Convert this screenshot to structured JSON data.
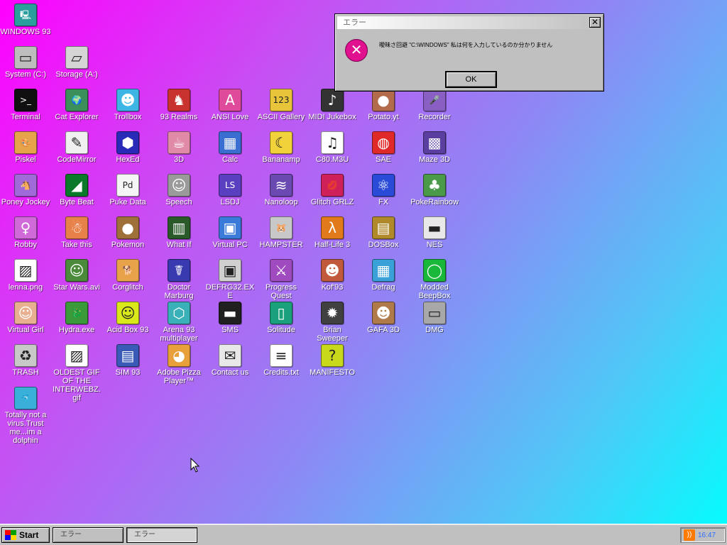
{
  "colors": {
    "gradient_start": "#ff00ff",
    "gradient_end": "#00ffff",
    "dialog_gray": "#c0c0c0",
    "error_icon": "#e0108f"
  },
  "desktop": {
    "icons": [
      {
        "label": "WINDOWS 93",
        "icon": "computer-icon",
        "glyph": "🖳",
        "bg": "#2a9d9d"
      },
      {
        "label": "System (C:)",
        "icon": "hard-drive-icon",
        "glyph": "▭",
        "bg": "#bdbdbd"
      },
      {
        "label": "Storage (A:)",
        "icon": "floppy-drive-icon",
        "glyph": "▱",
        "bg": "#d5d5d5"
      },
      {
        "label": "Terminal",
        "icon": "terminal-icon",
        "glyph": ">_",
        "bg": "#101010"
      },
      {
        "label": "Cat Explorer",
        "icon": "cat-explorer-icon",
        "glyph": "🌍",
        "bg": "#3a8f5a"
      },
      {
        "label": "Trollbox",
        "icon": "trollbox-icon",
        "glyph": "☻",
        "bg": "#3db6e6"
      },
      {
        "label": "93 Realms",
        "icon": "realms-icon",
        "glyph": "♞",
        "bg": "#c8322f"
      },
      {
        "label": "ANSI Love",
        "icon": "ansi-love-icon",
        "glyph": "A",
        "bg": "#e04a9a"
      },
      {
        "label": "ASCII Gallery",
        "icon": "ascii-gallery-icon",
        "glyph": "123",
        "bg": "#e8c43a"
      },
      {
        "label": "MIDI Jukebox",
        "icon": "midi-jukebox-icon",
        "glyph": "♪",
        "bg": "#333333"
      },
      {
        "label": "Potato.yt",
        "icon": "potato-icon",
        "glyph": "●",
        "bg": "#b26b4b"
      },
      {
        "label": "Recorder",
        "icon": "microphone-icon",
        "glyph": "🎤",
        "bg": "#8a5fc4"
      },
      {
        "label": "Piskel",
        "icon": "palette-icon",
        "glyph": "🎨",
        "bg": "#e6a34a"
      },
      {
        "label": "CodeMirror",
        "icon": "codemirror-icon",
        "glyph": "✎",
        "bg": "#f0f0f0"
      },
      {
        "label": "HexEd",
        "icon": "cube-icon",
        "glyph": "⬢",
        "bg": "#2a2ab8"
      },
      {
        "label": "3D",
        "icon": "teapot-icon",
        "glyph": "☕",
        "bg": "#e08aa8"
      },
      {
        "label": "Calc",
        "icon": "calculator-icon",
        "glyph": "▦",
        "bg": "#3a6fd1"
      },
      {
        "label": "Bananamp",
        "icon": "banana-icon",
        "glyph": "☾",
        "bg": "#f2d23a"
      },
      {
        "label": "C80.M3U",
        "icon": "speaker-file-icon",
        "glyph": "♫",
        "bg": "#ffffff"
      },
      {
        "label": "SAE",
        "icon": "ball-icon",
        "glyph": "◍",
        "bg": "#e02a2a"
      },
      {
        "label": "Maze 3D",
        "icon": "maze-icon",
        "glyph": "▩",
        "bg": "#5a3fa0"
      },
      {
        "label": "Poney Jockey",
        "icon": "pony-icon",
        "glyph": "🐴",
        "bg": "#a06ad8"
      },
      {
        "label": "Byte Beat",
        "icon": "bytebeat-icon",
        "glyph": "◢",
        "bg": "#0a7a2a"
      },
      {
        "label": "Puke Data",
        "icon": "pd-icon",
        "glyph": "Pd",
        "bg": "#f5f5f5"
      },
      {
        "label": "Speech",
        "icon": "face-icon",
        "glyph": "☺",
        "bg": "#9a9a9a"
      },
      {
        "label": "LSDJ",
        "icon": "lsdj-icon",
        "glyph": "LS",
        "bg": "#5a3fc0"
      },
      {
        "label": "Nanoloop",
        "icon": "nanoloop-icon",
        "glyph": "≋",
        "bg": "#6a4ab0"
      },
      {
        "label": "Glitch GRLZ",
        "icon": "lips-icon",
        "glyph": "💋",
        "bg": "#d0205a"
      },
      {
        "label": "FX",
        "icon": "atom-icon",
        "glyph": "⚛",
        "bg": "#2a4ad8"
      },
      {
        "label": "PokeRainbow",
        "icon": "pokerainbow-icon",
        "glyph": "♣",
        "bg": "#4a9a4a"
      },
      {
        "label": "Robby",
        "icon": "stick-figure-icon",
        "glyph": "♀",
        "bg": "#d06ad8"
      },
      {
        "label": "Take this",
        "icon": "old-man-icon",
        "glyph": "☃",
        "bg": "#e8804a"
      },
      {
        "label": "Pokemon",
        "icon": "pokemon-icon",
        "glyph": "●",
        "bg": "#a0703a"
      },
      {
        "label": "What If",
        "icon": "whatif-icon",
        "glyph": "▥",
        "bg": "#2a5a2a"
      },
      {
        "label": "Virtual PC",
        "icon": "virtual-pc-icon",
        "glyph": "▣",
        "bg": "#3a7ad8"
      },
      {
        "label": "HAMPSTER",
        "icon": "hamster-icon",
        "glyph": "🐹",
        "bg": "#c8c8c8"
      },
      {
        "label": "Half-Life 3",
        "icon": "lambda-icon",
        "glyph": "λ",
        "bg": "#e07a1a"
      },
      {
        "label": "DOSBox",
        "icon": "dosbox-icon",
        "glyph": "▤",
        "bg": "#b08a2a"
      },
      {
        "label": "NES",
        "icon": "nes-icon",
        "glyph": "▬",
        "bg": "#e8e8e8"
      },
      {
        "label": "lenna.png",
        "icon": "image-file-icon",
        "glyph": "▨",
        "bg": "#ffffff"
      },
      {
        "label": "Star Wars.avi",
        "icon": "yoda-icon",
        "glyph": "☺",
        "bg": "#4a8a3a"
      },
      {
        "label": "Corglitch",
        "icon": "corgi-icon",
        "glyph": "🐕",
        "bg": "#e8a24a"
      },
      {
        "label": "Doctor Marburg",
        "icon": "doctor-icon",
        "glyph": "☤",
        "bg": "#3a3ab0"
      },
      {
        "label": "DEFRG32.EXE",
        "icon": "defrag-monitor-icon",
        "glyph": "▣",
        "bg": "#d0d0d0"
      },
      {
        "label": "Progress Quest",
        "icon": "swords-icon",
        "glyph": "⚔",
        "bg": "#a04ac0"
      },
      {
        "label": "Kof'93",
        "icon": "fighter-icon",
        "glyph": "☻",
        "bg": "#c05a3a"
      },
      {
        "label": "Defrag",
        "icon": "defrag-icon",
        "glyph": "▦",
        "bg": "#3aa0d8"
      },
      {
        "label": "Modded BeepBox",
        "icon": "beepbox-icon",
        "glyph": "◯",
        "bg": "#1ab83a"
      },
      {
        "label": "Virtual Girl",
        "icon": "virtual-girl-icon",
        "glyph": "☺",
        "bg": "#e8b090"
      },
      {
        "label": "Hydra.exe",
        "icon": "hydra-icon",
        "glyph": "🐉",
        "bg": "#3a9a3a"
      },
      {
        "label": "Acid Box 93",
        "icon": "smiley-icon",
        "glyph": "☺",
        "bg": "#d8e81a"
      },
      {
        "label": "Arena 93 multiplayer",
        "icon": "arena-cube-icon",
        "glyph": "⬡",
        "bg": "#3ab0b8"
      },
      {
        "label": "SMS",
        "icon": "sms-console-icon",
        "glyph": "▬",
        "bg": "#202020"
      },
      {
        "label": "Solitude",
        "icon": "solitude-icon",
        "glyph": "▯",
        "bg": "#1aa07a"
      },
      {
        "label": "Brian Sweeper",
        "icon": "mine-icon",
        "glyph": "✹",
        "bg": "#404040"
      },
      {
        "label": "GAFA 3D",
        "icon": "doom-face-icon",
        "glyph": "☻",
        "bg": "#b07a4a"
      },
      {
        "label": "DMG",
        "icon": "dmg-icon",
        "glyph": "▭",
        "bg": "#a8a8a8"
      },
      {
        "label": "TRASH",
        "icon": "trash-icon",
        "glyph": "♻",
        "bg": "#c8c8c8"
      },
      {
        "label": "OLDEST GIF OF THE INTERWEBZ.gif",
        "icon": "gif-file-icon",
        "glyph": "▨",
        "bg": "#ffffff"
      },
      {
        "label": "SIM 93",
        "icon": "sim-book-icon",
        "glyph": "▤",
        "bg": "#3a5ab8"
      },
      {
        "label": "Adobe Pizza Player™",
        "icon": "pizza-icon",
        "glyph": "◕",
        "bg": "#e8a03a"
      },
      {
        "label": "Contact us",
        "icon": "contact-icon",
        "glyph": "✉",
        "bg": "#e8e8e8"
      },
      {
        "label": "Credits.txt",
        "icon": "text-file-icon",
        "glyph": "≡",
        "bg": "#ffffff"
      },
      {
        "label": "MANIFESTO",
        "icon": "question-icon",
        "glyph": "?",
        "bg": "#c8d81a"
      },
      {
        "label": "Totally not a virus.Trust me...im a dolphin",
        "icon": "dolphin-icon",
        "glyph": "🐬",
        "bg": "#3ab0d8"
      }
    ]
  },
  "dialog": {
    "title": "エラー",
    "close_glyph": "✕",
    "icon_glyph": "✕",
    "message": "曖昧さ回避 \"C:\\WINDOWS\" 私は何を入力しているのか分かりません",
    "ok_label": "OK"
  },
  "taskbar": {
    "start_label": "Start",
    "tasks": [
      "エラー",
      "エラー"
    ],
    "tray_time": "16:47",
    "rss_glyph": "))"
  }
}
